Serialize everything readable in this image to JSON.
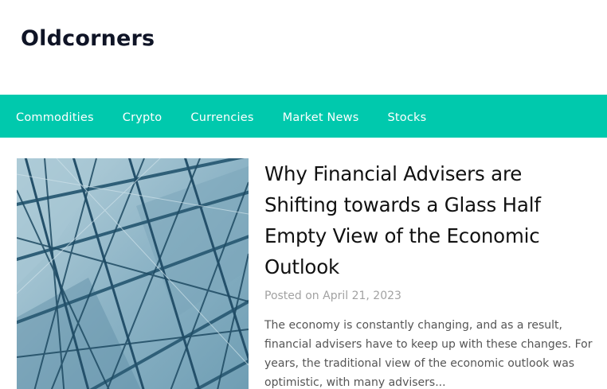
{
  "site": {
    "title": "Oldcorners"
  },
  "nav": {
    "items": [
      {
        "label": "Commodities"
      },
      {
        "label": "Crypto"
      },
      {
        "label": "Currencies"
      },
      {
        "label": "Market News"
      },
      {
        "label": "Stocks"
      }
    ]
  },
  "post": {
    "title": "Why Financial Advisers are Shifting towards a Glass Half Empty View of the Economic Outlook",
    "posted_prefix": "Posted on",
    "date": "April 21, 2023",
    "excerpt": "The economy is constantly changing, and as a result, financial advisers have to keep up with these changes. For years, the traditional view of the economic outlook was optimistic, with many advisers..."
  },
  "colors": {
    "nav_background": "#00c9ad",
    "title_text": "#0f1426",
    "meta_text": "#a2a2a2",
    "excerpt_text": "#555555"
  }
}
